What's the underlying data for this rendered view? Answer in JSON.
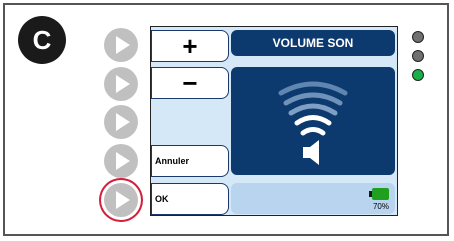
{
  "badge": {
    "letter": "C"
  },
  "screen": {
    "title": "VOLUME SON",
    "softkeys": [
      {
        "label": "+",
        "kind": "symbol"
      },
      {
        "label": "−",
        "kind": "symbol"
      },
      {
        "label": "",
        "kind": "blank"
      },
      {
        "label": "Annuler",
        "kind": "text"
      },
      {
        "label": "OK",
        "kind": "text"
      }
    ],
    "battery": {
      "percent_label": "70%",
      "level": 0.7
    }
  },
  "side_buttons": [
    {
      "icon": "play-arrow-icon",
      "highlighted": false
    },
    {
      "icon": "play-arrow-icon",
      "highlighted": false
    },
    {
      "icon": "play-arrow-icon",
      "highlighted": false
    },
    {
      "icon": "play-arrow-icon",
      "highlighted": false
    },
    {
      "icon": "play-arrow-icon",
      "highlighted": true
    }
  ],
  "leds": [
    {
      "color": "#707070"
    },
    {
      "color": "#707070"
    },
    {
      "color": "#19b04a"
    }
  ],
  "colors": {
    "highlight": "#d21f3c",
    "screen_dark": "#0d3a6e",
    "screen_light": "#d4e8f8"
  },
  "volume_icon": "volume-speaker-icon"
}
